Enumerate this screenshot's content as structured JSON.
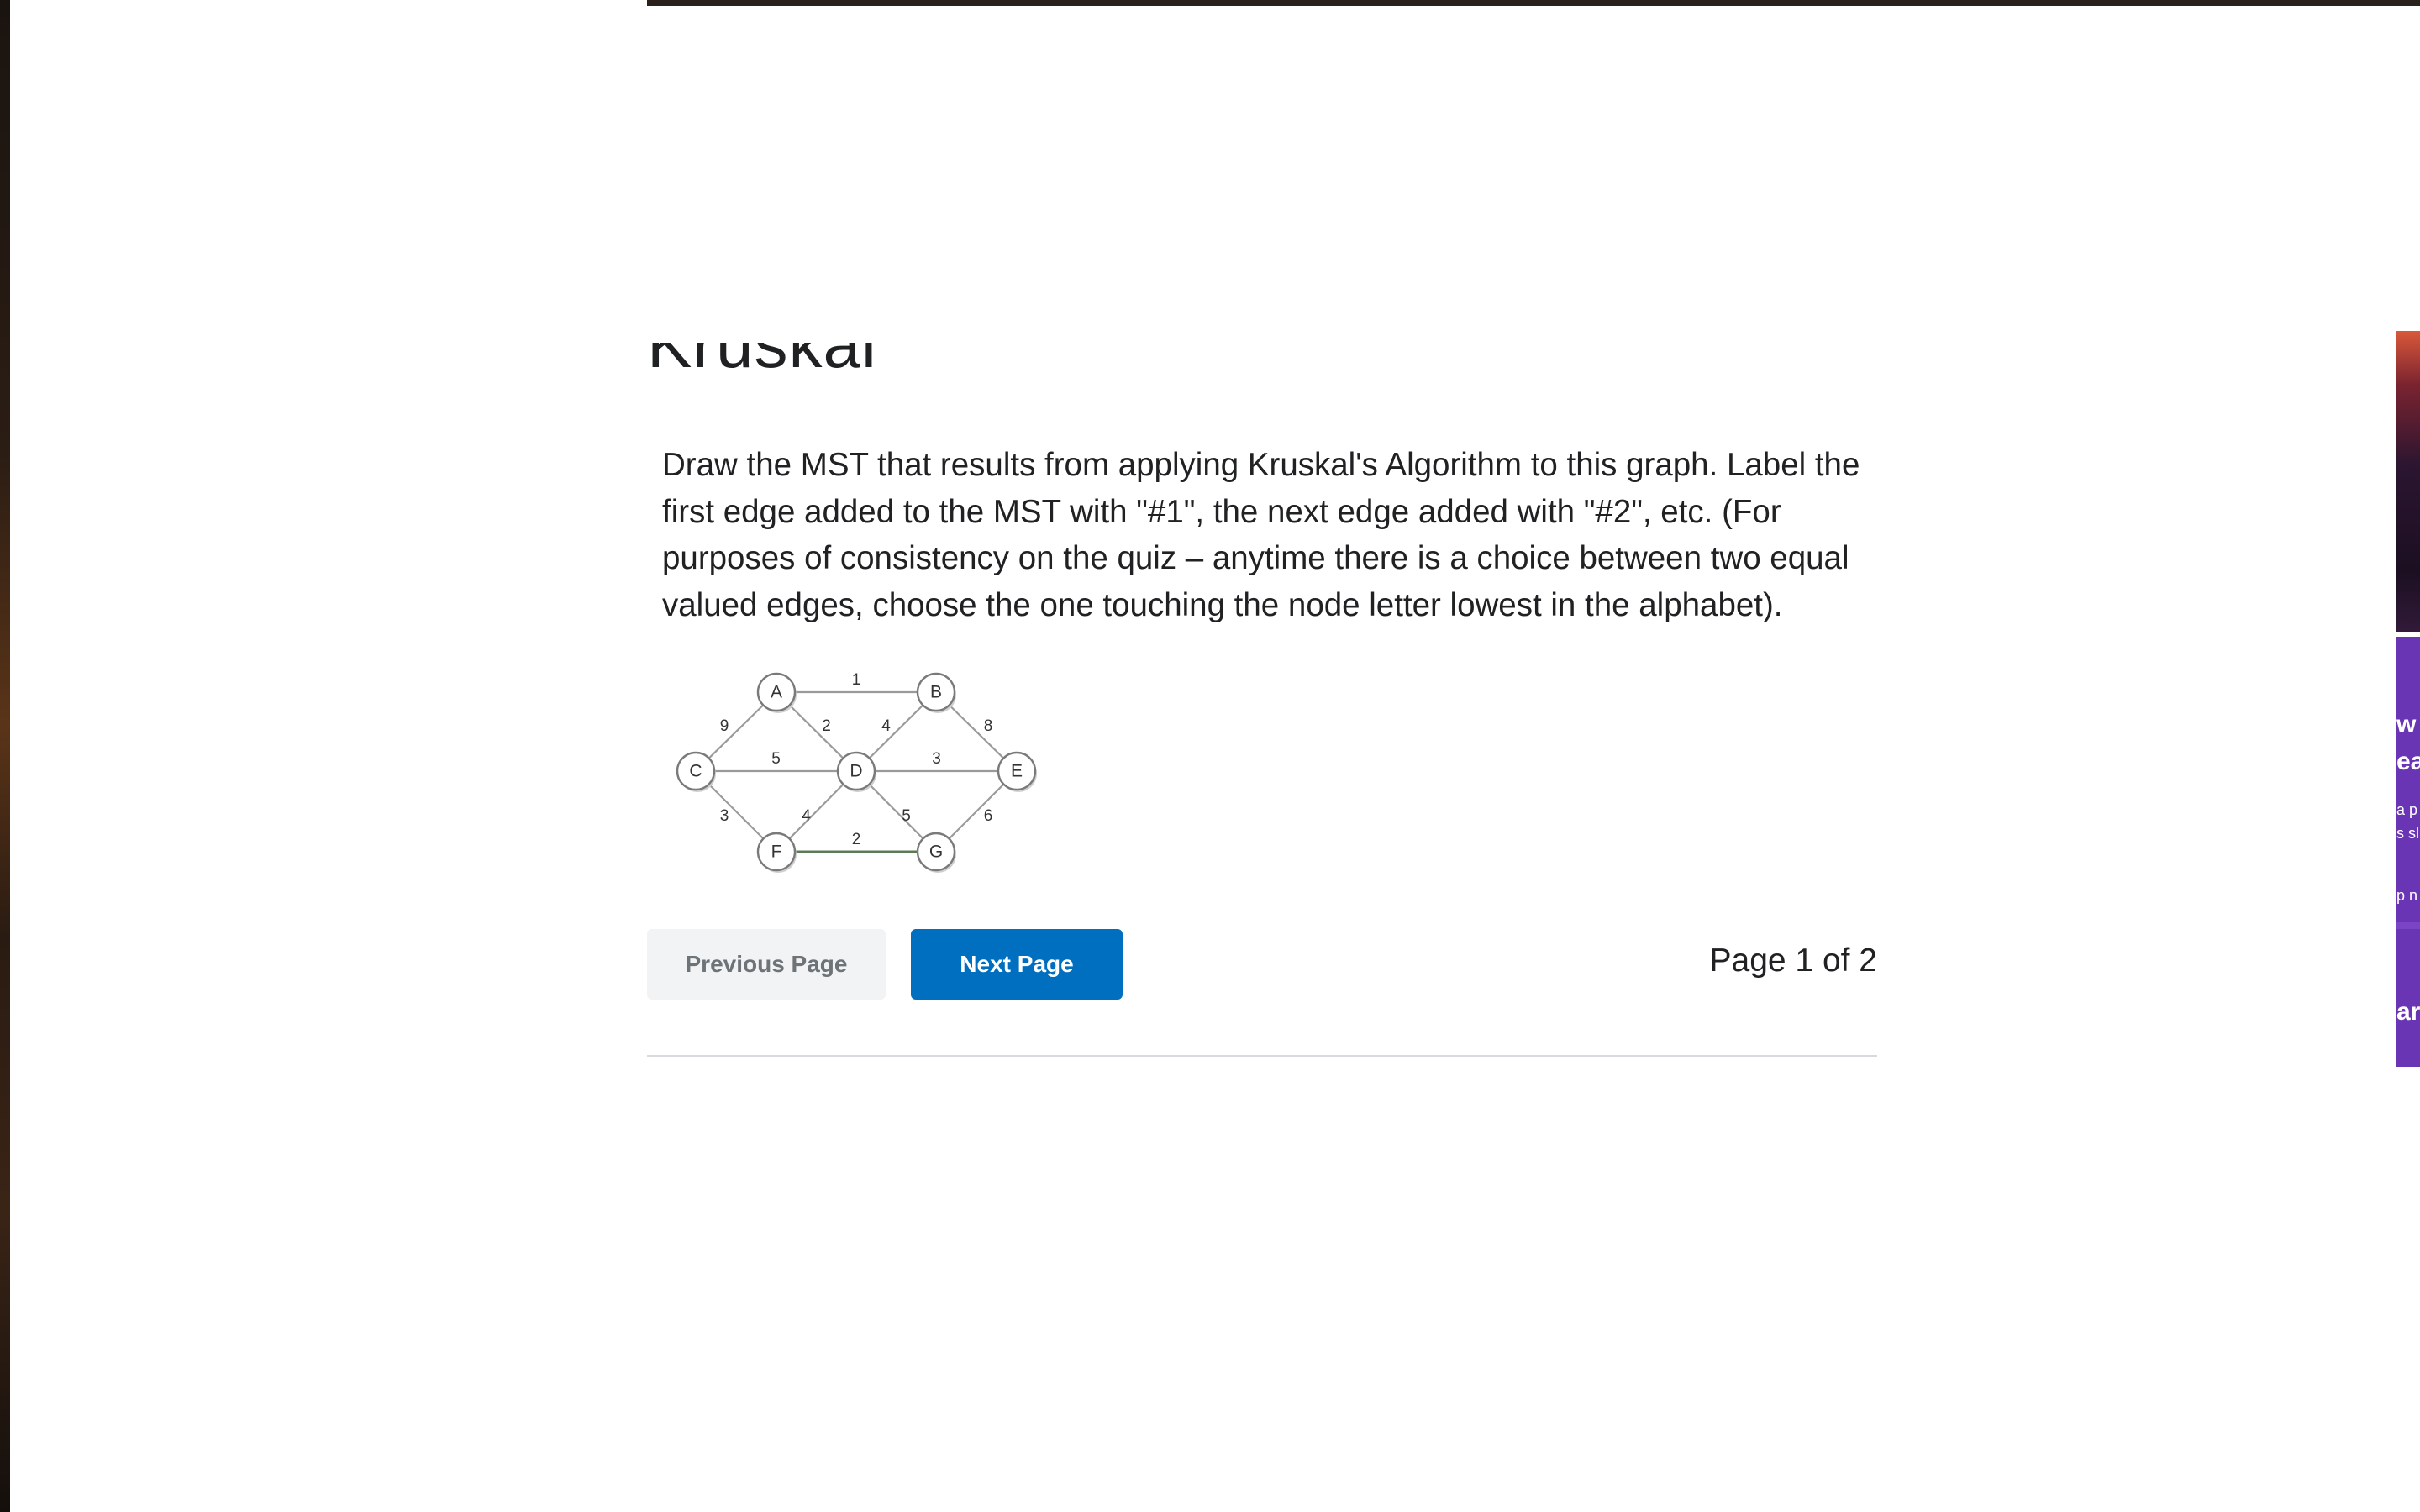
{
  "title_fragment": "Kruskal",
  "question_text": "Draw the MST that results from applying Kruskal's Algorithm to this graph.  Label the first edge added to the MST with \"#1\", the next edge added with \"#2\", etc.  (For purposes of consistency on the quiz – anytime there is a choice between two equal valued edges, choose the one touching the node letter lowest in the alphabet).",
  "graph": {
    "nodes": [
      "A",
      "B",
      "C",
      "D",
      "E",
      "F",
      "G"
    ],
    "edges": [
      {
        "from": "A",
        "to": "B",
        "weight": "1"
      },
      {
        "from": "C",
        "to": "A",
        "weight": "9"
      },
      {
        "from": "A",
        "to": "D",
        "weight": "2"
      },
      {
        "from": "B",
        "to": "D",
        "weight": "4"
      },
      {
        "from": "B",
        "to": "E",
        "weight": "8"
      },
      {
        "from": "C",
        "to": "D",
        "weight": "5"
      },
      {
        "from": "D",
        "to": "E",
        "weight": "3"
      },
      {
        "from": "C",
        "to": "F",
        "weight": "3"
      },
      {
        "from": "F",
        "to": "D",
        "weight": "4"
      },
      {
        "from": "D",
        "to": "G",
        "weight": "5"
      },
      {
        "from": "E",
        "to": "G",
        "weight": "6"
      },
      {
        "from": "F",
        "to": "G",
        "weight": "2"
      }
    ]
  },
  "navigation": {
    "prev_label": "Previous Page",
    "next_label": "Next Page",
    "page_indicator": "Page 1 of 2"
  },
  "right_panel": {
    "fragments": [
      "w",
      "ea",
      "a p",
      "s sl",
      "p n",
      "ar"
    ]
  },
  "colors": {
    "primary_button": "#006fbf",
    "disabled_button": "#f1f3f5",
    "text": "#202122"
  }
}
